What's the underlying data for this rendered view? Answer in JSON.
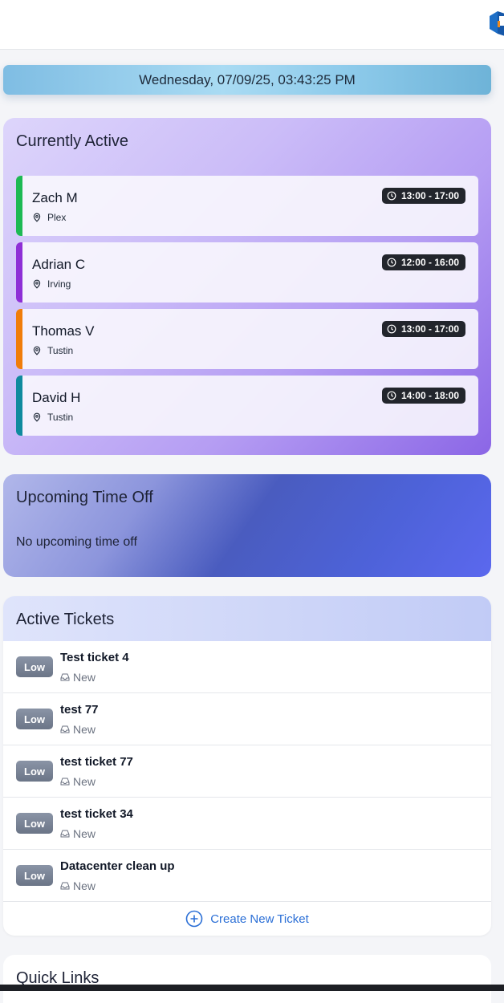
{
  "datetime": "Wednesday, 07/09/25, 03:43:25 PM",
  "active": {
    "title": "Currently Active",
    "shifts": [
      {
        "name": "Zach M",
        "location": "Plex",
        "time": "13:00 - 17:00",
        "color": "#1db954"
      },
      {
        "name": "Adrian C",
        "location": "Irving",
        "time": "12:00 - 16:00",
        "color": "#8e2fd6"
      },
      {
        "name": "Thomas V",
        "location": "Tustin",
        "time": "13:00 - 17:00",
        "color": "#f07d0a"
      },
      {
        "name": "David H",
        "location": "Tustin",
        "time": "14:00 - 18:00",
        "color": "#0f8a9e"
      }
    ]
  },
  "timeoff": {
    "title": "Upcoming Time Off",
    "empty_text": "No upcoming time off"
  },
  "tickets": {
    "title": "Active Tickets",
    "items": [
      {
        "priority": "Low",
        "title": "Test ticket 4",
        "status": "New"
      },
      {
        "priority": "Low",
        "title": "test 77",
        "status": "New"
      },
      {
        "priority": "Low",
        "title": "test ticket 77",
        "status": "New"
      },
      {
        "priority": "Low",
        "title": "test ticket 34",
        "status": "New"
      },
      {
        "priority": "Low",
        "title": "Datacenter clean up",
        "status": "New"
      }
    ],
    "create_label": "Create New Ticket"
  },
  "quick_links": {
    "title": "Quick Links"
  }
}
